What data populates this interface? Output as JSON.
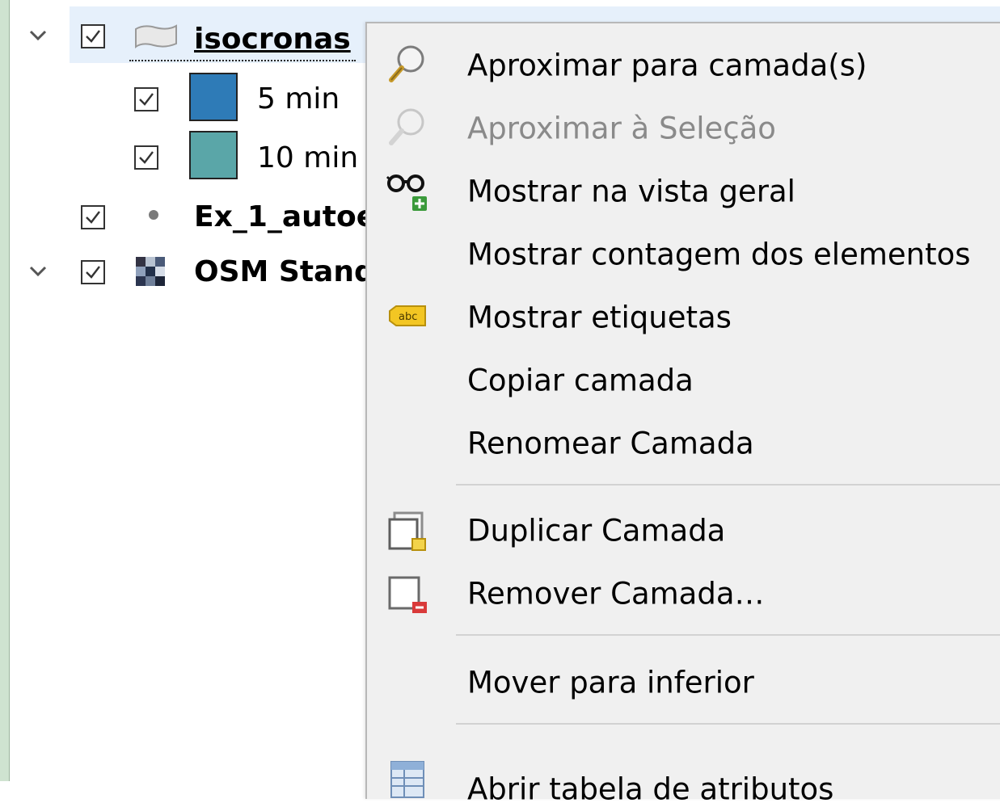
{
  "layers_panel": {
    "layers": [
      {
        "name": "isocronas",
        "checked": true,
        "expanded": true,
        "selected": true,
        "children": [
          {
            "label": "5 min",
            "color": "#2e7bb7",
            "checked": true
          },
          {
            "label": "10 min",
            "color": "#5aa6a8",
            "checked": true
          }
        ]
      },
      {
        "name": "Ex_1_autoe",
        "checked": true,
        "expanded": false
      },
      {
        "name": "OSM Stand",
        "checked": true,
        "expanded": true
      }
    ]
  },
  "context_menu": {
    "items": [
      {
        "label": "Aproximar para camada(s)",
        "icon": "zoom-to-layer-icon",
        "enabled": true
      },
      {
        "label": "Aproximar à Seleção",
        "icon": "zoom-to-selection-icon",
        "enabled": false
      },
      {
        "label": "Mostrar na vista geral",
        "icon": "show-in-overview-icon",
        "enabled": true
      },
      {
        "label": "Mostrar contagem dos elementos",
        "icon": "",
        "enabled": true
      },
      {
        "label": "Mostrar etiquetas",
        "icon": "labels-abc-icon",
        "enabled": true
      },
      {
        "label": "Copiar camada",
        "icon": "",
        "enabled": true
      },
      {
        "label": "Renomear Camada",
        "icon": "",
        "enabled": true
      },
      {
        "label": "Duplicar Camada",
        "icon": "duplicate-layer-icon",
        "enabled": true
      },
      {
        "label": "Remover Camada…",
        "icon": "remove-layer-icon",
        "enabled": true
      },
      {
        "label": "Mover para  inferior",
        "icon": "",
        "enabled": true
      },
      {
        "label": "Abrir tabela de atributos",
        "icon": "attribute-table-icon",
        "enabled": true
      }
    ]
  },
  "colors": {
    "selection_bg": "#e6f0fb",
    "menu_bg": "#f0f0f0",
    "disabled_text": "#8a8a8a"
  }
}
